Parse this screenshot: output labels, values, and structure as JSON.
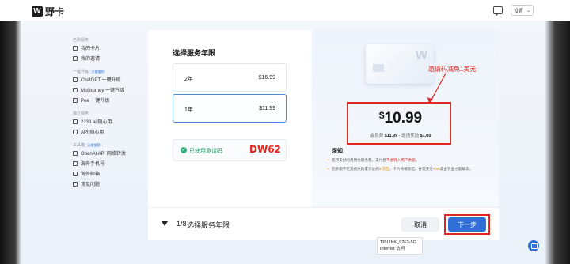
{
  "app": {
    "logo_mark": "W",
    "name": "野卡"
  },
  "header": {
    "settings_label": "设置",
    "settings_chevron": "⌄"
  },
  "sidebar": {
    "groups": [
      {
        "label": "已购服务",
        "items": [
          {
            "label": "我的卡片",
            "icon": "card-icon"
          },
          {
            "label": "我的邀请",
            "icon": "invite-icon"
          }
        ]
      },
      {
        "label": "一键升级",
        "tag": "大佬推荐",
        "items": [
          {
            "label": "ChatGPT 一键升级",
            "icon": "openai-icon"
          },
          {
            "label": "Midjourney 一键升级",
            "icon": "sail-icon"
          },
          {
            "label": "Poe 一键升级",
            "icon": "chat-icon"
          }
        ]
      },
      {
        "label": "独立服务",
        "items": [
          {
            "label": "2233.ai 随心用",
            "icon": "star-icon"
          },
          {
            "label": "API 随心用",
            "icon": "api-icon"
          }
        ]
      },
      {
        "label": "工具箱",
        "tag": "大佬推荐",
        "items": [
          {
            "label": "OpenAI API 网络转发",
            "icon": "forward-icon"
          },
          {
            "label": "海外手机号",
            "icon": "phone-icon"
          },
          {
            "label": "海外邮箱",
            "icon": "mail-icon"
          },
          {
            "label": "常见问题",
            "icon": "help-icon"
          }
        ]
      }
    ]
  },
  "plan": {
    "title": "选择服务年限",
    "options": [
      {
        "label": "2年",
        "price": "$16.99",
        "selected": false
      },
      {
        "label": "1年",
        "price": "$11.99",
        "selected": true
      }
    ],
    "coupon_status": "已使用邀请码",
    "coupon_code": "DW62"
  },
  "summary": {
    "card_mark": "W",
    "annotation": "邀请码减免1美元",
    "price_currency": "$",
    "price_amount": "10.99",
    "member_price_label": "会员费",
    "member_price": "$11.99",
    "discount_label": "邀请奖励",
    "discount": "$1.00",
    "separator": "-",
    "notice_title": "须知",
    "notice_1a": "您所支付的费用为服务费，支付后",
    "notice_1b": "不会转入用户余额",
    "notice_1c": "。",
    "notice_2a": "因余额不足消费失败累计达到",
    "notice_2b": "3 次后",
    "notice_2c": "，卡片将被冻结，并需支付",
    "notice_2d": "0.99",
    "notice_2e": "美金罚金才能解冻。"
  },
  "footer": {
    "chevron": "▼",
    "step": "1/8",
    "step_title": "选择服务年限",
    "cancel_label": "取消",
    "next_label": "下一步"
  },
  "wifi_popup": {
    "network": "TP-LINK_92F2-5G",
    "status": "Internet 访问"
  },
  "colors": {
    "accent": "#2f6fd6",
    "annotation_red": "#e0261f",
    "success": "#36b37e"
  }
}
